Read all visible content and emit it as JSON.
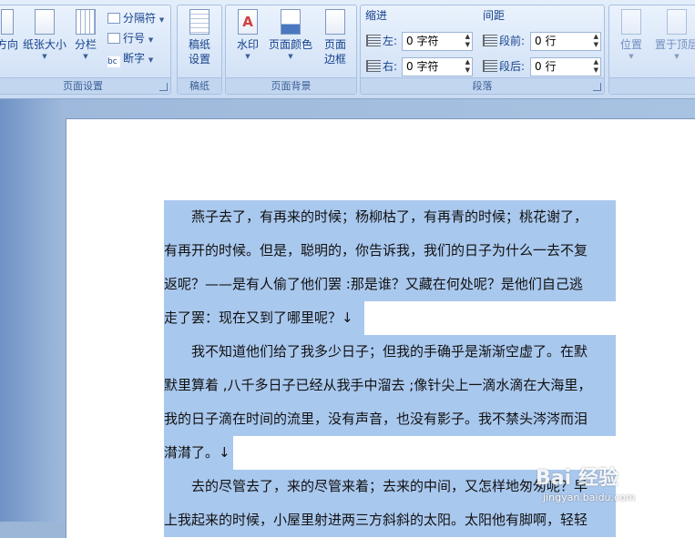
{
  "ribbon": {
    "page_setup": {
      "orientation_label": "方向",
      "size_label": "纸张大小",
      "columns_label": "分栏",
      "breaks_label": "分隔符",
      "line_numbers_label": "行号",
      "hyphenation_label": "断字",
      "group_label": "页面设置"
    },
    "manuscript": {
      "button_label": "稿纸设置",
      "group_label": "稿纸"
    },
    "page_background": {
      "watermark_label": "水印",
      "page_color_label": "页面颜色",
      "page_borders_label": "页面边框",
      "group_label": "页面背景"
    },
    "paragraph": {
      "indent_title": "缩进",
      "spacing_title": "间距",
      "indent_left_label": "左:",
      "indent_left_value": "0 字符",
      "indent_right_label": "右:",
      "indent_right_value": "0 字符",
      "spacing_before_label": "段前:",
      "spacing_before_value": "0 行",
      "spacing_after_label": "段后:",
      "spacing_after_value": "0 行",
      "group_label": "段落"
    },
    "arrange": {
      "position_label": "位置",
      "bring_front_label": "置于顶层"
    }
  },
  "document": {
    "lines": [
      "　　燕子去了，有再来的时候；杨柳枯了，有再青的时候；桃花谢了，",
      "有再开的时候。但是，聪明的，你告诉我，我们的日子为什么一去不复",
      "返呢？——是有人偷了他们罢 :那是谁？又藏在何处呢？是他们自己逃",
      "走了罢：现在又到了哪里呢？↓",
      "　　我不知道他们给了我多少日子；但我的手确乎是渐渐空虚了。在默",
      "默里算着 ,八千多日子已经从我手中溜去 ;像针尖上一滴水滴在大海里，",
      "我的日子滴在时间的流里，没有声音，也没有影子。我不禁头涔涔而泪",
      "潸潸了。↓",
      "　　去的尽管去了，来的尽管来着；去来的中间，又怎样地匆匆呢？早",
      "上我起来的时候，小屋里射进两三方斜斜的太阳。太阳他有脚啊，轻轻"
    ]
  },
  "watermark": {
    "logo_text": "Bai 经验",
    "url_text": "jingyan.baidu.com"
  },
  "colors": {
    "selection": "#a9c8ee",
    "ribbon_text": "#15428b"
  }
}
